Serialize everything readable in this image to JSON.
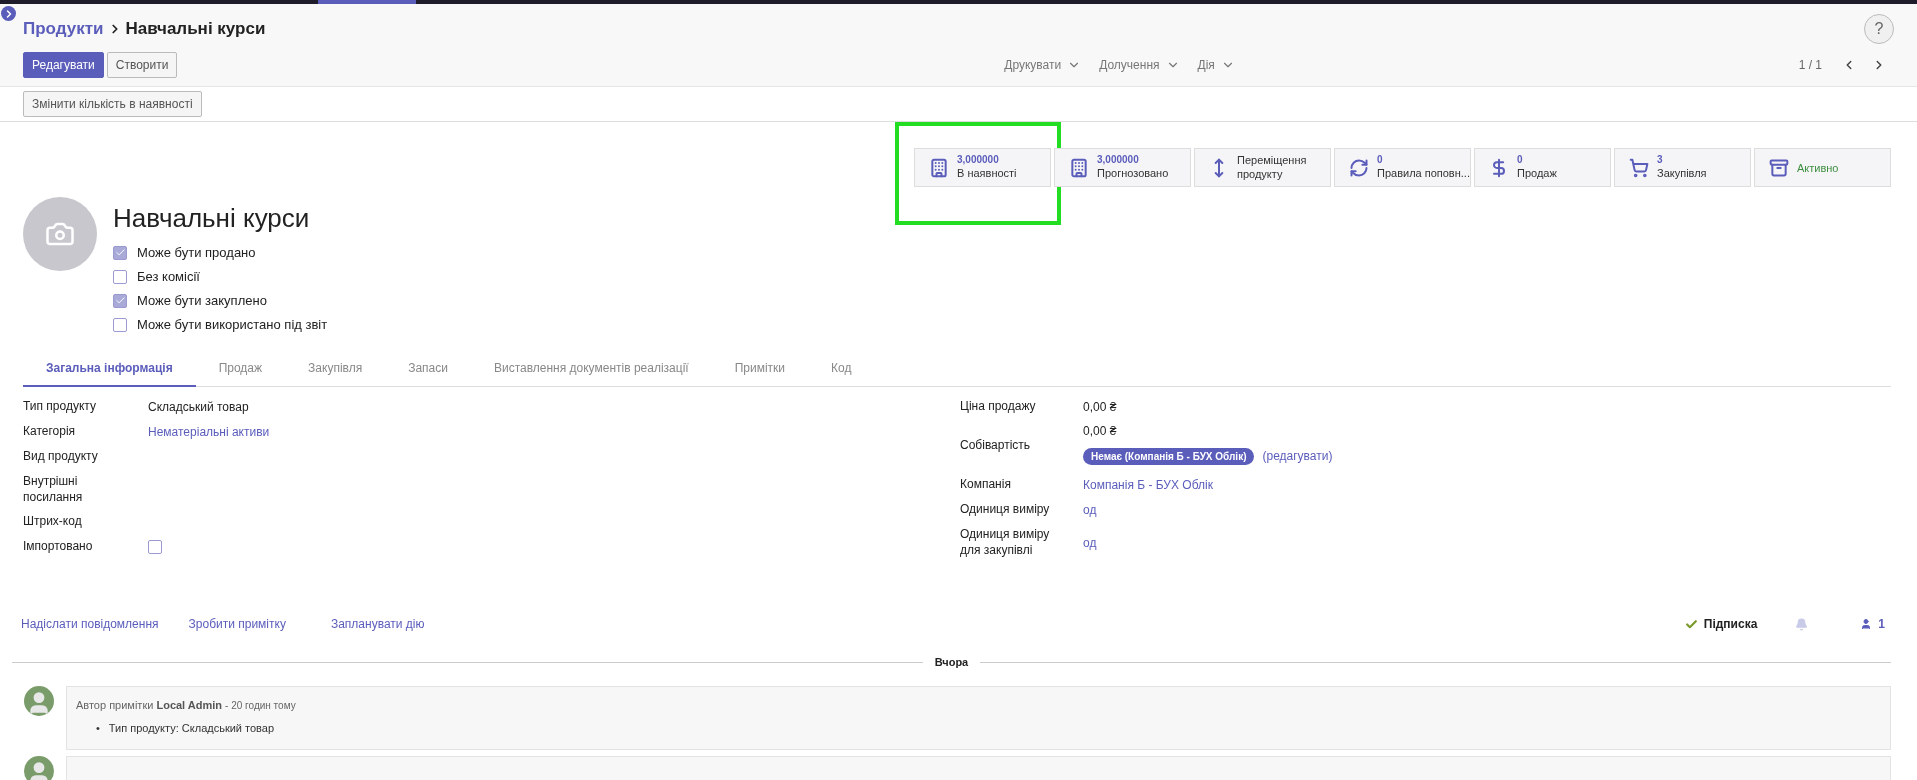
{
  "breadcrumb": {
    "parent": "Продукти",
    "current": "Навчальні курси"
  },
  "help": "?",
  "buttons": [
    {
      "label": "Редагувати",
      "primary": true
    },
    {
      "label": "Створити",
      "primary": false
    }
  ],
  "menus": [
    "Друкувати",
    "Долучення",
    "Дія"
  ],
  "pager": "1 / 1",
  "action_buttons": [
    "Змінити кількість в наявності"
  ],
  "stat_buttons": [
    {
      "kind": "building",
      "value": "3,000000",
      "label": "В наявності",
      "highlighted": true
    },
    {
      "kind": "building",
      "value": "3,000000",
      "label": "Прогнозовано",
      "highlighted": false
    },
    {
      "kind": "move",
      "label": "Переміщення продукту",
      "highlighted": false
    },
    {
      "kind": "refresh",
      "value": "0",
      "label": "Правила поповн...",
      "highlighted": false
    },
    {
      "kind": "dollar",
      "value": "0",
      "label": "Продаж",
      "highlighted": false
    },
    {
      "kind": "cart",
      "value": "3",
      "label": "Закупівля",
      "highlighted": false
    },
    {
      "kind": "archive",
      "label": "Активно",
      "highlighted": false
    }
  ],
  "product": {
    "name": "Навчальні курси",
    "checkboxes": [
      {
        "label": "Може бути продано",
        "checked": true
      },
      {
        "label": "Без комісії",
        "checked": false
      },
      {
        "label": "Може бути закуплено",
        "checked": true
      },
      {
        "label": "Може бути використано під звіт",
        "checked": false
      }
    ]
  },
  "tabs": [
    {
      "label": "Загальна інформація",
      "selected": true
    },
    {
      "label": "Продаж",
      "selected": false
    },
    {
      "label": "Закупівля",
      "selected": false
    },
    {
      "label": "Запаси",
      "selected": false
    },
    {
      "label": "Виставлення документів реалізації",
      "selected": false
    },
    {
      "label": "Примітки",
      "selected": false
    },
    {
      "label": "Код",
      "selected": false
    }
  ],
  "left_fields": [
    {
      "kind": "text",
      "label": "Тип продукту",
      "value": "Складський товар"
    },
    {
      "kind": "link",
      "label": "Категорія",
      "value": "Нематеріальні активи"
    },
    {
      "kind": "text",
      "label": "Вид продукту"
    },
    {
      "kind": "text",
      "label": "Внутрішні посилання"
    },
    {
      "kind": "text",
      "label": "Штрих-код"
    },
    {
      "kind": "checkbox",
      "label": "Імпортовано",
      "checked": false
    }
  ],
  "right_fields": [
    {
      "kind": "text",
      "label": "Ціна продажу",
      "value": "0,00 ₴"
    },
    {
      "kind": "cost",
      "label": "Собівартість",
      "value": "0,00 ₴",
      "badge": "Немає (Компанія Б - БУХ Облік)",
      "link": "(редагувати)"
    },
    {
      "kind": "link",
      "label": "Компанія",
      "value": "Компанія Б - БУХ Облік"
    },
    {
      "kind": "link",
      "label": "Одиниця виміру",
      "value": "од"
    },
    {
      "kind": "link",
      "label": "Одиниця виміру для закупівлі",
      "value": "од"
    }
  ],
  "chatter": {
    "actions": [
      "Надіслати повідомлення",
      "Зробити примітку",
      "Запланувати дію"
    ],
    "follow": "Підписка",
    "followers": "1",
    "date_separator": "Вчора",
    "messages": [
      {
        "kind": "note",
        "prefix": "Автор примітки",
        "author": "Local Admin",
        "time": "- 20 годин тому",
        "changes": [
          {
            "bullet": "•",
            "text": "Тип продукту: Складський товар"
          }
        ]
      },
      {
        "kind": "cut_off"
      }
    ]
  }
}
